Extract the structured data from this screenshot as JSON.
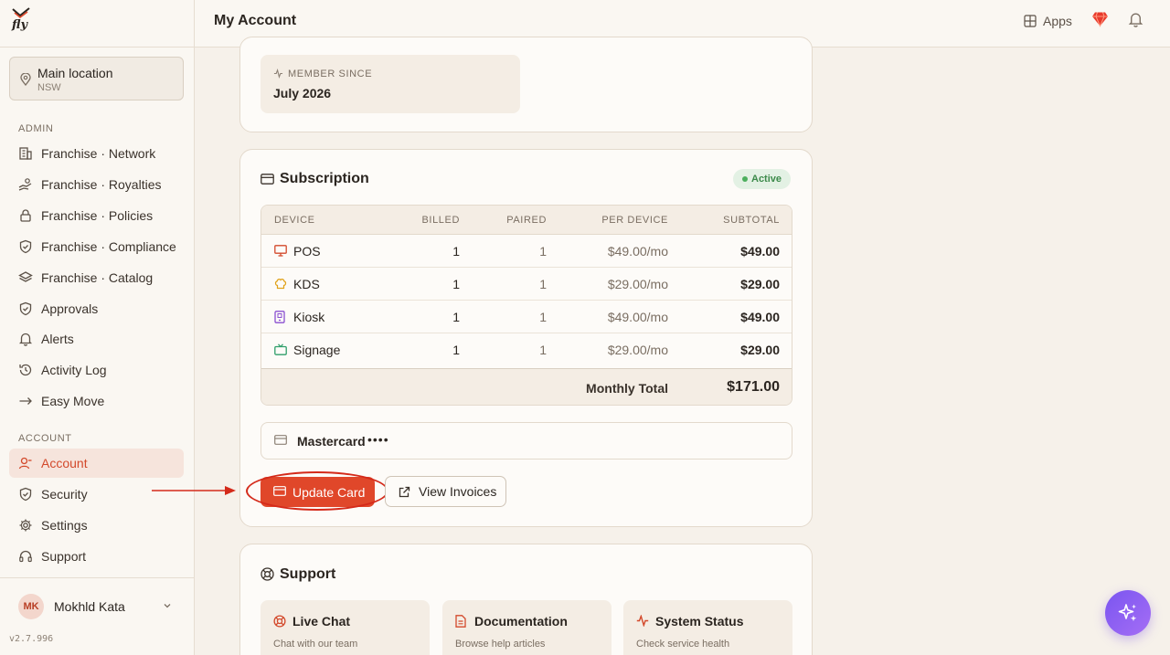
{
  "app": {
    "logo_text": "fly"
  },
  "location": {
    "name": "Main location",
    "region": "NSW"
  },
  "sidebar": {
    "admin_label": "ADMIN",
    "admin_items": [
      {
        "label": "Franchise · Network",
        "icon": "building-icon"
      },
      {
        "label": "Franchise · Royalties",
        "icon": "hand-coins-icon"
      },
      {
        "label": "Franchise · Policies",
        "icon": "lock-icon"
      },
      {
        "label": "Franchise · Compliance",
        "icon": "shield-check-icon"
      },
      {
        "label": "Franchise · Catalog",
        "icon": "layers-icon"
      },
      {
        "label": "Approvals",
        "icon": "shield-check-icon"
      },
      {
        "label": "Alerts",
        "icon": "bell-icon"
      },
      {
        "label": "Activity Log",
        "icon": "history-icon"
      },
      {
        "label": "Easy Move",
        "icon": "arrow-right-icon"
      }
    ],
    "account_label": "ACCOUNT",
    "account_items": [
      {
        "label": "Account",
        "icon": "user-icon",
        "active": true
      },
      {
        "label": "Security",
        "icon": "shield-icon"
      },
      {
        "label": "Settings",
        "icon": "gear-icon"
      },
      {
        "label": "Support",
        "icon": "headset-icon"
      }
    ]
  },
  "user": {
    "initials": "MK",
    "name": "Mokhld Kata"
  },
  "version": "v2.7.996",
  "header": {
    "title": "My Account",
    "apps_label": "Apps"
  },
  "member": {
    "label": "MEMBER SINCE",
    "value": "July 2026"
  },
  "subscription": {
    "title": "Subscription",
    "status": "Active",
    "columns": [
      "DEVICE",
      "BILLED",
      "PAIRED",
      "PER DEVICE",
      "SUBTOTAL"
    ],
    "rows": [
      {
        "device": "POS",
        "billed": "1",
        "paired": "1",
        "per_device": "$49.00/mo",
        "subtotal": "$49.00",
        "icon": "monitor-icon",
        "color": "#d3492b"
      },
      {
        "device": "KDS",
        "billed": "1",
        "paired": "1",
        "per_device": "$29.00/mo",
        "subtotal": "$29.00",
        "icon": "chef-hat-icon",
        "color": "#e0a21a"
      },
      {
        "device": "Kiosk",
        "billed": "1",
        "paired": "1",
        "per_device": "$49.00/mo",
        "subtotal": "$49.00",
        "icon": "tablet-icon",
        "color": "#8a4fd0"
      },
      {
        "device": "Signage",
        "billed": "1",
        "paired": "1",
        "per_device": "$29.00/mo",
        "subtotal": "$29.00",
        "icon": "tv-icon",
        "color": "#2f9e6a"
      }
    ],
    "total_label": "Monthly Total",
    "total_value": "$171.00",
    "card_brand": "Mastercard",
    "card_mask": "••••",
    "update_card_label": "Update Card",
    "view_invoices_label": "View Invoices"
  },
  "support": {
    "title": "Support",
    "items": [
      {
        "title": "Live Chat",
        "subtitle": "Chat with our team",
        "icon": "life-buoy-icon",
        "color": "#d3492b"
      },
      {
        "title": "Documentation",
        "subtitle": "Browse help articles",
        "icon": "document-icon",
        "color": "#d3492b"
      },
      {
        "title": "System Status",
        "subtitle": "Check service health",
        "icon": "activity-icon",
        "color": "#d3492b"
      }
    ]
  },
  "colors": {
    "accent": "#e0472a",
    "active_badge": "#3c8a4a",
    "fab": "#8a5ff2"
  }
}
